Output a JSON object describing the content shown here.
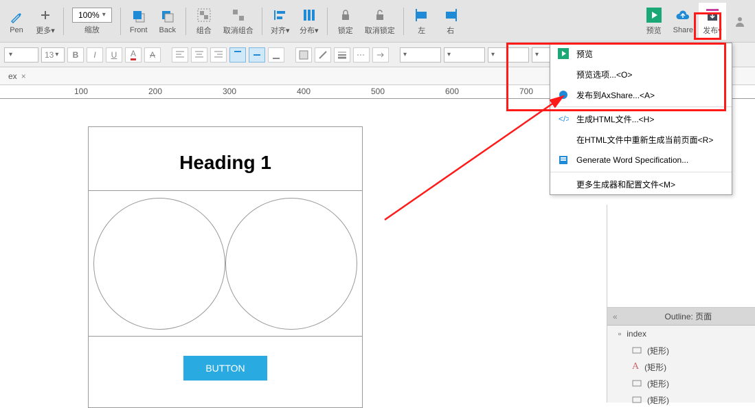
{
  "toolbar": {
    "pen": "Pen",
    "more": "更多▾",
    "zoom": "100%",
    "zoom_lbl": "缩放",
    "front": "Front",
    "back": "Back",
    "group": "组合",
    "ungroup": "取消组合",
    "align": "对齐▾",
    "distribute": "分布▾",
    "lock": "锁定",
    "unlock": "取消锁定",
    "left": "左",
    "right": "右",
    "preview": "预览",
    "share": "Share",
    "publish": "发布▾"
  },
  "format": {
    "size": "13"
  },
  "tab": {
    "name": "ex",
    "close": "×"
  },
  "ruler": [
    "100",
    "200",
    "300",
    "400",
    "500",
    "600",
    "700"
  ],
  "artboard": {
    "heading": "Heading 1",
    "button": "BUTTON"
  },
  "menu": {
    "preview": "预览",
    "preview_opts": "预览选项...<O>",
    "axshare": "发布到AxShare...<A>",
    "gen_html": "生成HTML文件...<H>",
    "regen_html": "在HTML文件中重新生成当前页面<R>",
    "gen_word": "Generate Word Specification...",
    "more_gen": "更多生成器和配置文件<M>"
  },
  "outline": {
    "title": "Outline: 页面",
    "root": "index",
    "items": [
      "(矩形)",
      "(矩形)",
      "(矩形)",
      "(矩形)"
    ]
  }
}
